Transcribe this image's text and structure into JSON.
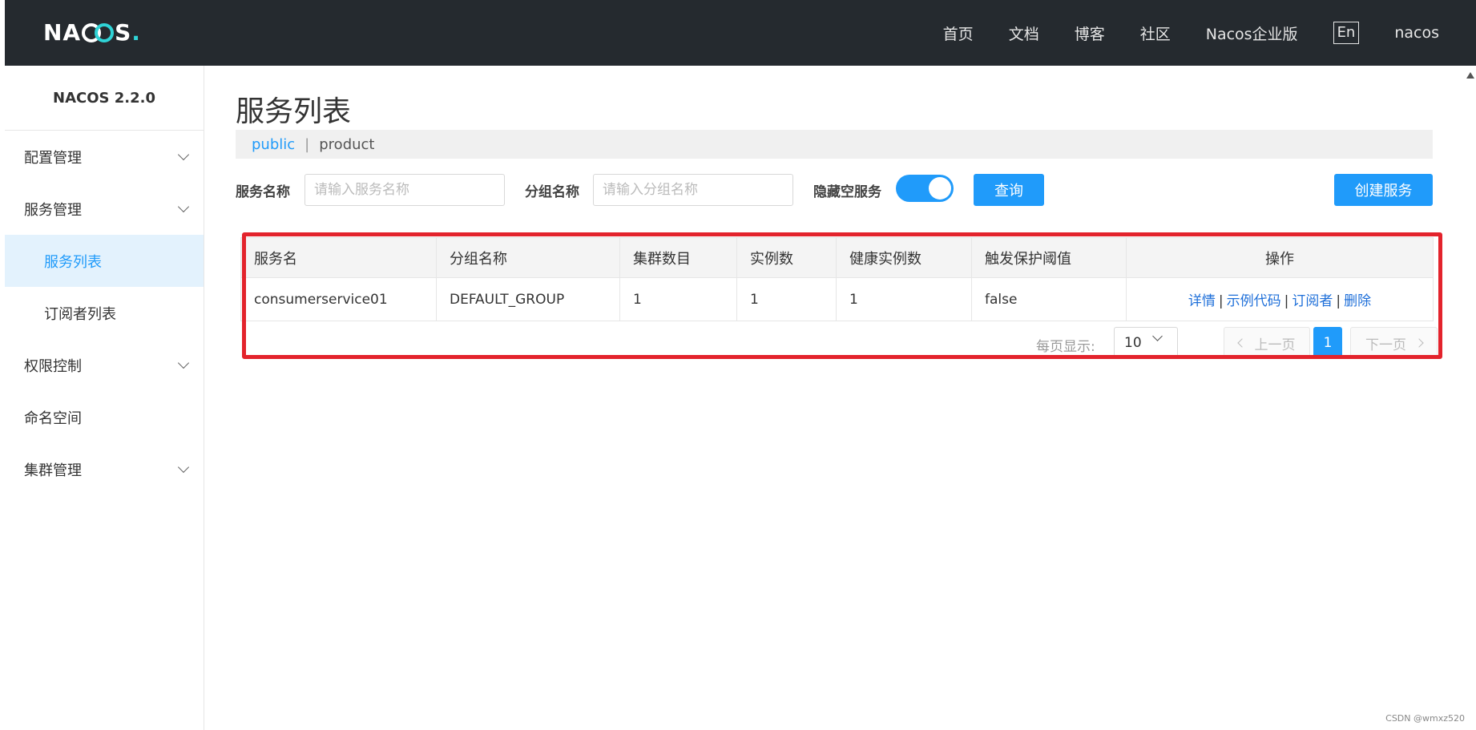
{
  "header": {
    "logo_text": "NACOS.",
    "nav": [
      "首页",
      "文档",
      "博客",
      "社区",
      "Nacos企业版"
    ],
    "lang": "En",
    "user": "nacos"
  },
  "sidebar": {
    "version": "NACOS 2.2.0",
    "items": [
      {
        "label": "配置管理",
        "expandable": true
      },
      {
        "label": "服务管理",
        "expandable": true
      },
      {
        "label": "服务列表",
        "sub": true,
        "active": true
      },
      {
        "label": "订阅者列表",
        "sub": true
      },
      {
        "label": "权限控制",
        "expandable": true
      },
      {
        "label": "命名空间"
      },
      {
        "label": "集群管理",
        "expandable": true
      }
    ]
  },
  "page": {
    "title": "服务列表",
    "namespace_link": "public",
    "namespace_sep": "|",
    "namespace_current": "product"
  },
  "filter": {
    "service_label": "服务名称",
    "service_placeholder": "请输入服务名称",
    "group_label": "分组名称",
    "group_placeholder": "请输入分组名称",
    "hide_empty_label": "隐藏空服务",
    "hide_empty_on": true,
    "query_button": "查询",
    "create_button": "创建服务"
  },
  "table": {
    "columns": [
      "服务名",
      "分组名称",
      "集群数目",
      "实例数",
      "健康实例数",
      "触发保护阈值",
      "操作"
    ],
    "rows": [
      {
        "name": "consumerservice01",
        "group": "DEFAULT_GROUP",
        "clusters": "1",
        "instances": "1",
        "healthy": "1",
        "protect": "false"
      }
    ],
    "ops": [
      "详情",
      "示例代码",
      "订阅者",
      "删除"
    ],
    "op_sep": "|"
  },
  "pager": {
    "page_size_label": "每页显示:",
    "page_size": "10",
    "prev": "上一页",
    "next": "下一页",
    "current": "1"
  },
  "watermark": "CSDN @wmxz520",
  "colors": {
    "header_bg": "#252a2f",
    "accent": "#209bfa",
    "highlight": "#e3232c"
  }
}
